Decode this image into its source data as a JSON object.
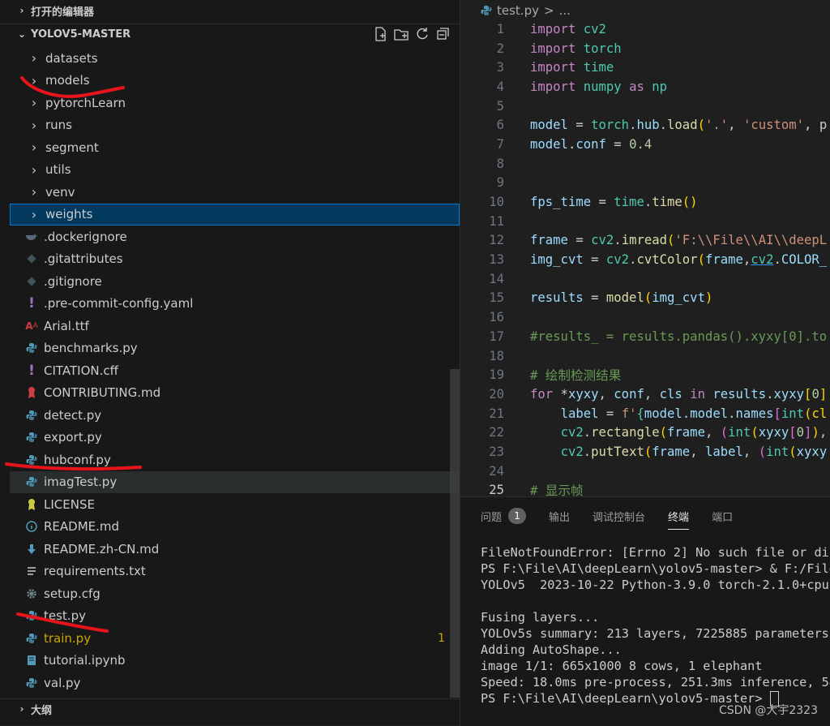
{
  "explorer": {
    "open_editors_label": "打开的编辑器",
    "project_label": "YOLOV5-MASTER",
    "outline_label": "大纲",
    "items": [
      {
        "label": "datasets",
        "kind": "folder",
        "icon": "chevron-right-icon"
      },
      {
        "label": "models",
        "kind": "folder",
        "icon": "chevron-right-icon"
      },
      {
        "label": "pytorchLearn",
        "kind": "folder",
        "icon": "chevron-right-icon"
      },
      {
        "label": "runs",
        "kind": "folder",
        "icon": "chevron-right-icon"
      },
      {
        "label": "segment",
        "kind": "folder",
        "icon": "chevron-right-icon"
      },
      {
        "label": "utils",
        "kind": "folder",
        "icon": "chevron-right-icon"
      },
      {
        "label": "venv",
        "kind": "folder",
        "icon": "chevron-right-icon"
      },
      {
        "label": "weights",
        "kind": "folder",
        "icon": "chevron-right-icon",
        "selected": true
      },
      {
        "label": ".dockerignore",
        "kind": "file",
        "icon": "docker-icon"
      },
      {
        "label": ".gitattributes",
        "kind": "file",
        "icon": "git-icon"
      },
      {
        "label": ".gitignore",
        "kind": "file",
        "icon": "git-icon"
      },
      {
        "label": ".pre-commit-config.yaml",
        "kind": "file",
        "icon": "exclamation-icon"
      },
      {
        "label": "Arial.ttf",
        "kind": "file",
        "icon": "font-icon"
      },
      {
        "label": "benchmarks.py",
        "kind": "file",
        "icon": "python-icon"
      },
      {
        "label": "CITATION.cff",
        "kind": "file",
        "icon": "exclamation-icon"
      },
      {
        "label": "CONTRIBUTING.md",
        "kind": "file",
        "icon": "ribbon-icon"
      },
      {
        "label": "detect.py",
        "kind": "file",
        "icon": "python-icon"
      },
      {
        "label": "export.py",
        "kind": "file",
        "icon": "python-icon"
      },
      {
        "label": "hubconf.py",
        "kind": "file",
        "icon": "python-icon"
      },
      {
        "label": "imagTest.py",
        "kind": "file",
        "icon": "python-icon",
        "hovered": true
      },
      {
        "label": "LICENSE",
        "kind": "file",
        "icon": "license-icon"
      },
      {
        "label": "README.md",
        "kind": "file",
        "icon": "info-icon"
      },
      {
        "label": "README.zh-CN.md",
        "kind": "file",
        "icon": "download-arrow-icon"
      },
      {
        "label": "requirements.txt",
        "kind": "file",
        "icon": "lines-icon"
      },
      {
        "label": "setup.cfg",
        "kind": "file",
        "icon": "gear-icon"
      },
      {
        "label": "test.py",
        "kind": "file",
        "icon": "python-icon"
      },
      {
        "label": "train.py",
        "kind": "file",
        "icon": "python-icon",
        "warning": true,
        "badge": "1"
      },
      {
        "label": "tutorial.ipynb",
        "kind": "file",
        "icon": "notebook-icon"
      },
      {
        "label": "val.py",
        "kind": "file",
        "icon": "python-icon"
      }
    ]
  },
  "editor": {
    "breadcrumb": {
      "file": "test.py",
      "separator": ">",
      "more": "..."
    },
    "line_numbers": [
      "1",
      "2",
      "3",
      "4",
      "5",
      "6",
      "7",
      "8",
      "9",
      "10",
      "11",
      "12",
      "13",
      "14",
      "15",
      "16",
      "17",
      "18",
      "19",
      "20",
      "21",
      "22",
      "23",
      "24",
      "25"
    ],
    "code": {
      "l1": [
        "import",
        " ",
        "cv2"
      ],
      "l2": [
        "import",
        " ",
        "torch"
      ],
      "l3": [
        "import",
        " ",
        "time"
      ],
      "l4": [
        "import",
        " ",
        "numpy",
        " ",
        "as",
        " ",
        "np"
      ],
      "l6": [
        "model",
        " = ",
        "torch",
        ".",
        "hub",
        ".",
        "load",
        "(",
        "'.'",
        ", ",
        "'custom'",
        ", p"
      ],
      "l7": [
        "model",
        ".",
        "conf",
        " = ",
        "0.4"
      ],
      "l10": [
        "fps_time",
        " = ",
        "time",
        ".",
        "time",
        "()"
      ],
      "l12": [
        "frame",
        " = ",
        "cv2",
        ".",
        "imread",
        "(",
        "'F:\\\\File\\\\AI\\\\deepL"
      ],
      "l13": [
        "img_cvt",
        " = ",
        "cv2",
        ".",
        "cvtColor",
        "(",
        "frame",
        ",",
        "cv2",
        ".",
        "COLOR_"
      ],
      "l15": [
        "results",
        " = ",
        "model",
        "(",
        "img_cvt",
        ")"
      ],
      "l17": "#results_ = results.pandas().xyxy[0].to",
      "l19": "# 绘制检测结果",
      "l20": [
        "for",
        " *",
        "xyxy",
        ", ",
        "conf",
        ", ",
        "cls",
        " ",
        "in",
        " ",
        "results",
        ".",
        "xyxy",
        "[",
        "0",
        "]"
      ],
      "l21": [
        "    ",
        "label",
        " = ",
        "f'",
        "{",
        "model",
        ".",
        "model",
        ".",
        "names",
        "[",
        "int",
        "(cl"
      ],
      "l22": [
        "    ",
        "cv2",
        ".",
        "rectangle",
        "(",
        "frame",
        ", ",
        "(",
        "int",
        "(",
        "xyxy",
        "[",
        "0",
        "]",
        ")",
        ","
      ],
      "l23": [
        "    ",
        "cv2",
        ".",
        "putText",
        "(",
        "frame",
        ", ",
        "label",
        ", ",
        "(",
        "int",
        "(",
        "xyxy"
      ],
      "l25": "# 显示帧"
    }
  },
  "panel": {
    "tabs": [
      {
        "label": "问题",
        "count": "1"
      },
      {
        "label": "输出"
      },
      {
        "label": "调试控制台"
      },
      {
        "label": "终端",
        "active": true
      },
      {
        "label": "端口"
      }
    ],
    "terminal_lines": [
      "FileNotFoundError: [Errno 2] No such file or dir",
      "PS F:\\File\\AI\\deepLearn\\yolov5-master> & F:/File",
      "YOLOv5  2023-10-22 Python-3.9.0 torch-2.1.0+cpu",
      "",
      "Fusing layers...",
      "YOLOv5s summary: 213 layers, 7225885 parameters,",
      "Adding AutoShape...",
      "image 1/1: 665x1000 8 cows, 1 elephant",
      "Speed: 18.0ms pre-process, 251.3ms inference, 54",
      "PS F:\\File\\AI\\deepLearn\\yolov5-master> "
    ],
    "watermark": "CSDN @大宇2323"
  },
  "colors": {
    "annotation": "#e8141b",
    "selection_border": "#0078d4",
    "python": "#519aba",
    "warning": "#cca700"
  }
}
